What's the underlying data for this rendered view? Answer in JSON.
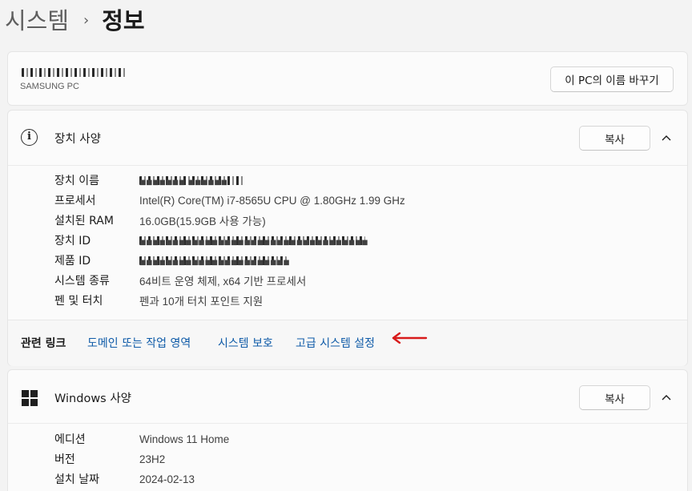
{
  "breadcrumb": {
    "parent": "시스템",
    "separator": "›",
    "current": "정보"
  },
  "device_card": {
    "pc_name": "■■■■ ■■ ■■■",
    "pc_model": "SAMSUNG PC",
    "rename_button": "이 PC의 이름 바꾸기"
  },
  "device_specs": {
    "title": "장치 사양",
    "copy_button": "복사",
    "rows": [
      {
        "label": "장치 이름",
        "value": "■■■■■■■ ■■■■■■"
      },
      {
        "label": "프로세서",
        "value": "Intel(R) Core(TM) i7-8565U CPU @ 1.80GHz   1.99 GHz"
      },
      {
        "label": "설치된 RAM",
        "value": "16.0GB(15.9GB 사용 가능)"
      },
      {
        "label": "장치 ID",
        "value": "■■■■■■■■■■■■■■■■■■■■■■■■■■■■■■■■■■■"
      },
      {
        "label": "제품 ID",
        "value": "■■■■■■■■■■■■■■■■■■■■■■■"
      },
      {
        "label": "시스템 종류",
        "value": "64비트 운영 체제, x64 기반 프로세서"
      },
      {
        "label": "펜 및 터치",
        "value": "펜과 10개 터치 포인트 지원"
      }
    ]
  },
  "related_links": {
    "label": "관련 링크",
    "links": [
      "도메인 또는 작업 영역",
      "시스템 보호",
      "고급 시스템 설정"
    ],
    "annotation_color": "#d81b1b"
  },
  "windows_specs": {
    "title": "Windows 사양",
    "copy_button": "복사",
    "rows": [
      {
        "label": "에디션",
        "value": "Windows 11 Home"
      },
      {
        "label": "버전",
        "value": "23H2"
      },
      {
        "label": "설치 날짜",
        "value": "2024-02-13"
      }
    ]
  },
  "colors": {
    "link": "#0f5ba8",
    "background": "#f3f3f3",
    "card": "#fbfbfb"
  }
}
